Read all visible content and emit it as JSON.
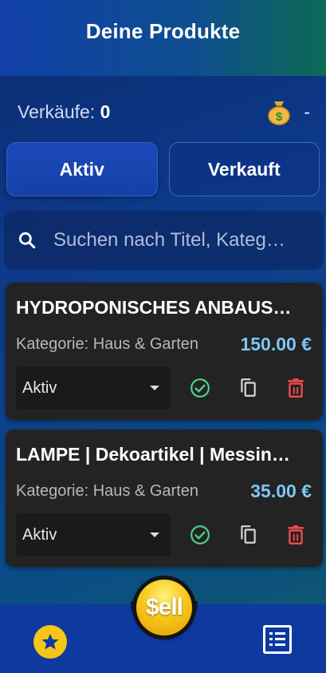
{
  "header": {
    "title": "Deine Produkte"
  },
  "stats": {
    "sales_label": "Verkäufe:",
    "sales_count": "0",
    "revenue": "-"
  },
  "tabs": [
    {
      "label": "Aktiv",
      "active": true
    },
    {
      "label": "Verkauft",
      "active": false
    }
  ],
  "search": {
    "placeholder": "Suchen nach Titel, Kateg…",
    "value": ""
  },
  "products": [
    {
      "title": "HYDROPONISCHES ANBAUS…",
      "category": "Kategorie: Haus & Garten",
      "price": "150.00 €",
      "status": "Aktiv"
    },
    {
      "title": "LAMPE | Dekoartikel | Messin…",
      "category": "Kategorie: Haus & Garten",
      "price": "35.00 €",
      "status": "Aktiv"
    }
  ],
  "fab": {
    "label": "$ell"
  },
  "colors": {
    "accent": "#1440a8",
    "price": "#7ec6f5",
    "check": "#4cd38a",
    "delete": "#f04b4b",
    "star": "#f5c518"
  },
  "icons": [
    "money-bag-icon",
    "search-icon",
    "check-circle-icon",
    "copy-icon",
    "delete-icon",
    "star-icon",
    "list-icon",
    "chevron-down-icon"
  ]
}
